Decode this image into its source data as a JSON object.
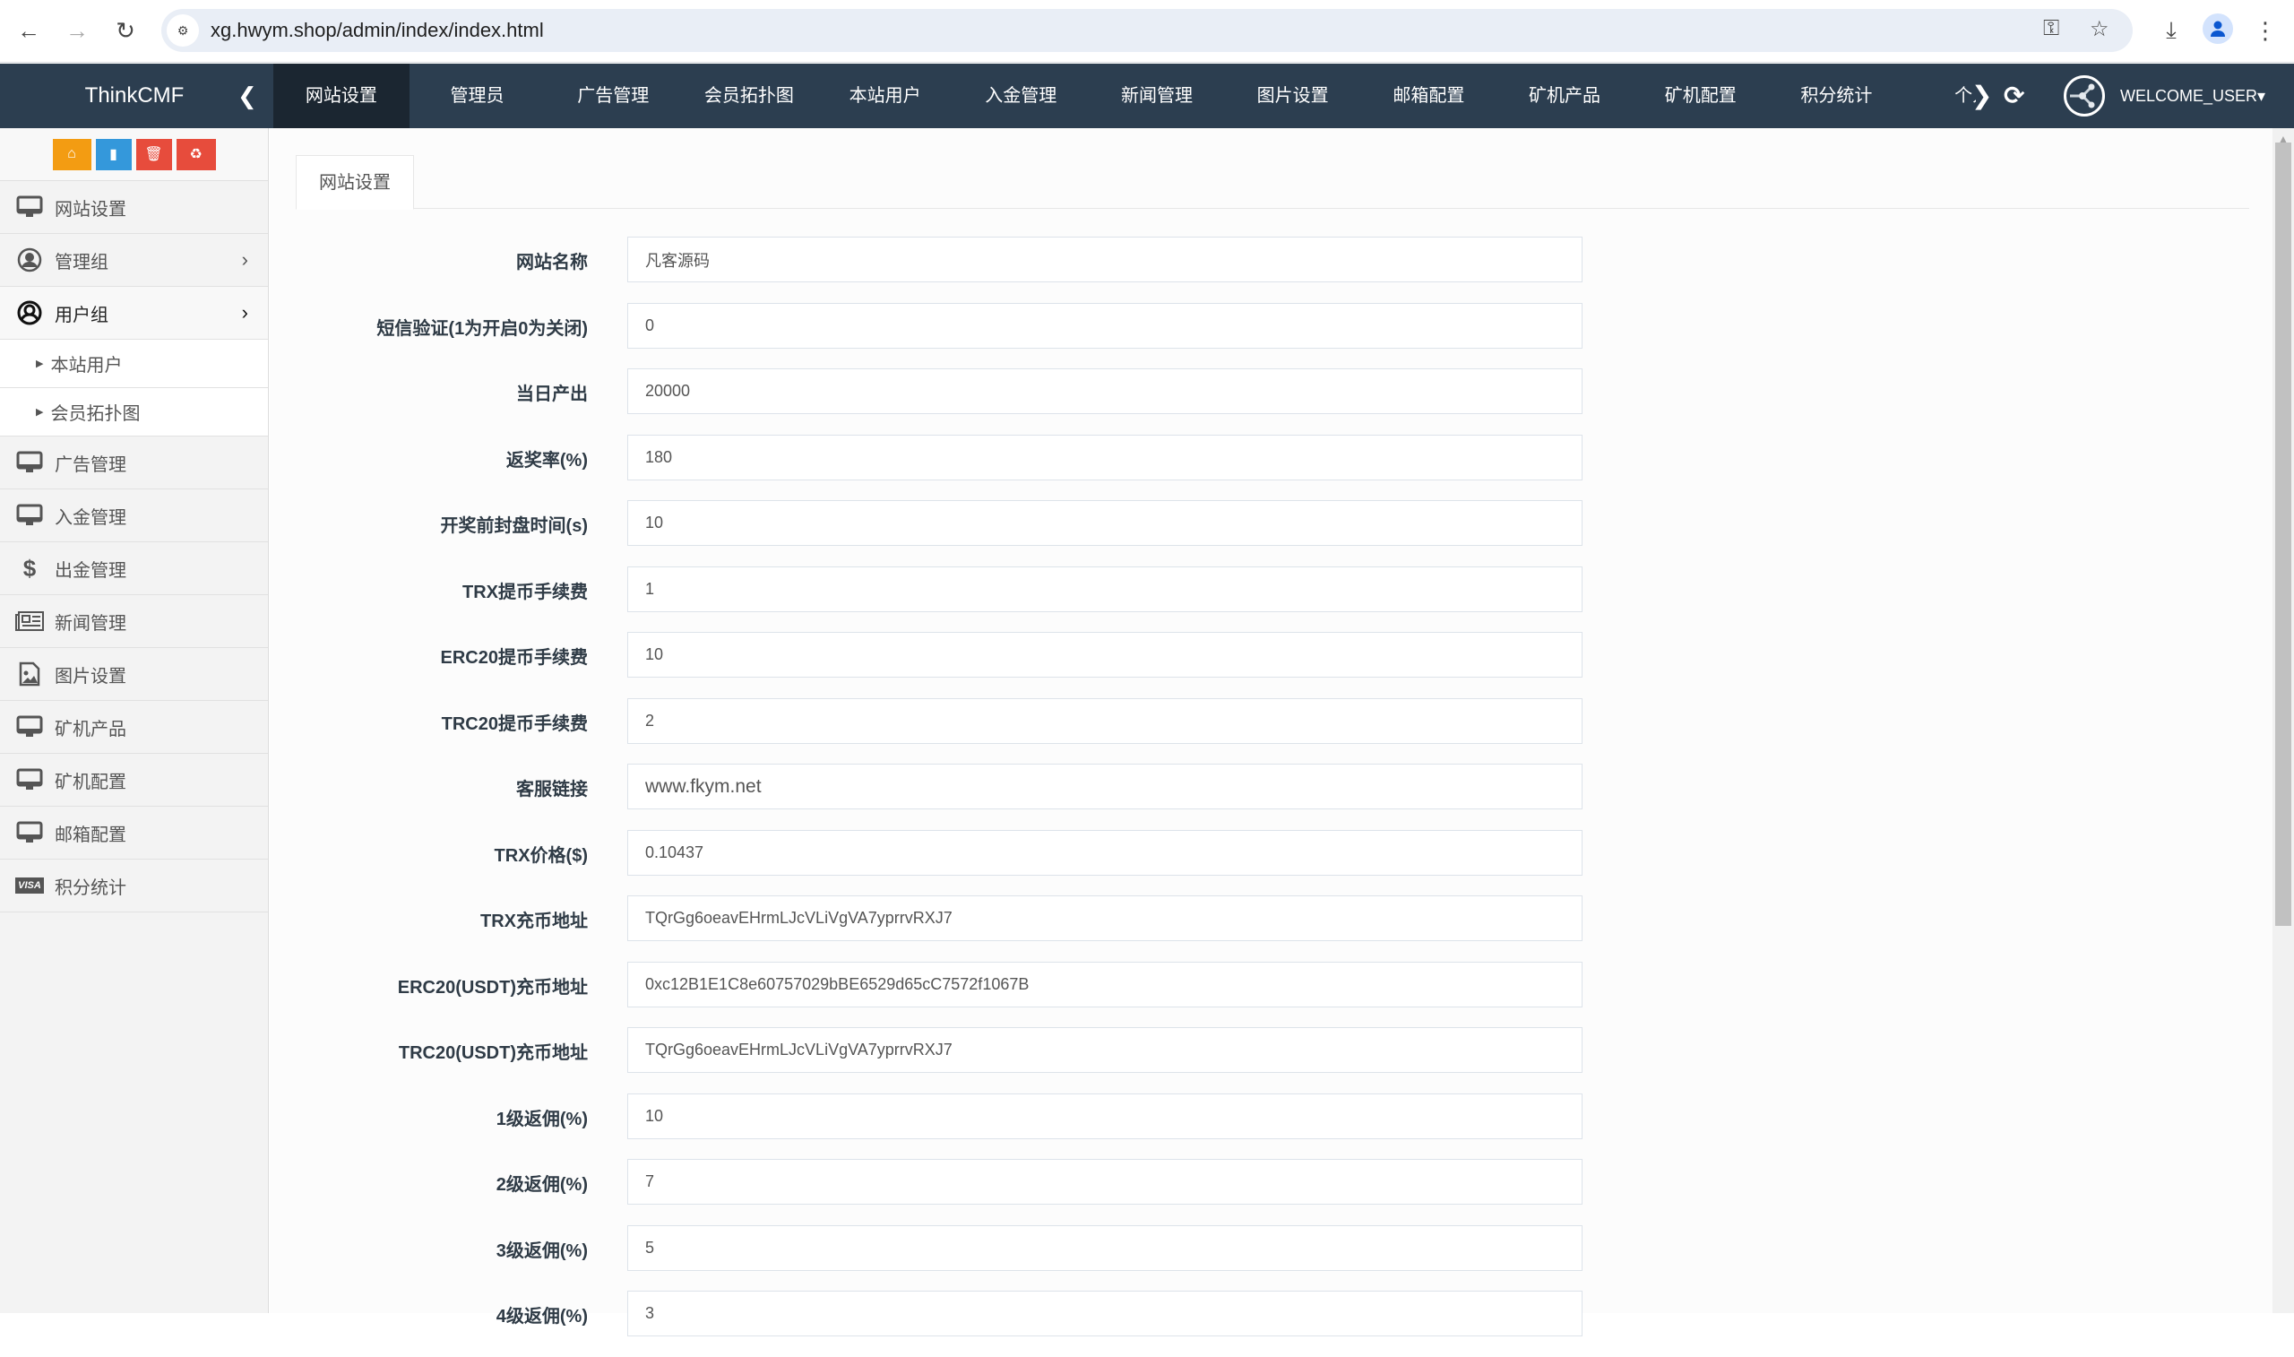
{
  "browser": {
    "url": "xg.hwym.shop/admin/index/index.html",
    "back_icon": "←",
    "forward_icon": "→",
    "reload_icon": "↻"
  },
  "topnav": {
    "logo": "ThinkCMF",
    "items": [
      {
        "label": "网站设置",
        "active": true
      },
      {
        "label": "管理员"
      },
      {
        "label": "广告管理"
      },
      {
        "label": "会员拓扑图"
      },
      {
        "label": "本站用户"
      },
      {
        "label": "入金管理"
      },
      {
        "label": "新闻管理"
      },
      {
        "label": "图片设置"
      },
      {
        "label": "邮箱配置"
      },
      {
        "label": "矿机产品"
      },
      {
        "label": "矿机配置"
      },
      {
        "label": "积分统计"
      },
      {
        "label": "个人"
      }
    ],
    "user": "WELCOME_USER",
    "dropdown_caret": "▾"
  },
  "sidebar": {
    "quick_buttons": [
      {
        "name": "home",
        "color": "#f39c12"
      },
      {
        "name": "file",
        "color": "#3498db"
      },
      {
        "name": "trash",
        "color": "#e74c3c"
      },
      {
        "name": "recycle",
        "color": "#e74c3c"
      }
    ],
    "items": [
      {
        "label": "网站设置",
        "icon": "monitor"
      },
      {
        "label": "管理组",
        "icon": "user-circle",
        "has_children": true
      },
      {
        "label": "用户组",
        "icon": "user-circle",
        "has_children": true,
        "expanded": true,
        "children": [
          {
            "label": "本站用户"
          },
          {
            "label": "会员拓扑图"
          }
        ]
      },
      {
        "label": "广告管理",
        "icon": "monitor"
      },
      {
        "label": "入金管理",
        "icon": "monitor"
      },
      {
        "label": "出金管理",
        "icon": "dollar"
      },
      {
        "label": "新闻管理",
        "icon": "newspaper"
      },
      {
        "label": "图片设置",
        "icon": "image-file"
      },
      {
        "label": "矿机产品",
        "icon": "monitor"
      },
      {
        "label": "矿机配置",
        "icon": "monitor"
      },
      {
        "label": "邮箱配置",
        "icon": "monitor"
      },
      {
        "label": "积分统计",
        "icon": "visa-card"
      }
    ]
  },
  "content": {
    "tab": "网站设置",
    "fields": [
      {
        "label": "网站名称",
        "value": "凡客源码"
      },
      {
        "label": "短信验证(1为开启0为关闭)",
        "value": "0"
      },
      {
        "label": "当日产出",
        "value": "20000"
      },
      {
        "label": "返奖率(%)",
        "value": "180"
      },
      {
        "label": "开奖前封盘时间(s)",
        "value": "10"
      },
      {
        "label": "TRX提币手续费",
        "value": "1"
      },
      {
        "label": "ERC20提币手续费",
        "value": "10"
      },
      {
        "label": "TRC20提币手续费",
        "value": "2"
      },
      {
        "label": "客服链接",
        "value": "www.fkym.net"
      },
      {
        "label": "TRX价格($)",
        "value": "0.10437"
      },
      {
        "label": "TRX充币地址",
        "value": "TQrGg6oeavEHrmLJcVLiVgVA7yprrvRXJ7"
      },
      {
        "label": "ERC20(USDT)充币地址",
        "value": "0xc12B1E1C8e60757029bBE6529d65cC7572f1067B"
      },
      {
        "label": "TRC20(USDT)充币地址",
        "value": "TQrGg6oeavEHrmLJcVLiVgVA7yprrvRXJ7"
      },
      {
        "label": "1级返佣(%)",
        "value": "10"
      },
      {
        "label": "2级返佣(%)",
        "value": "7"
      },
      {
        "label": "3级返佣(%)",
        "value": "5"
      },
      {
        "label": "4级返佣(%)",
        "value": "3"
      }
    ]
  }
}
